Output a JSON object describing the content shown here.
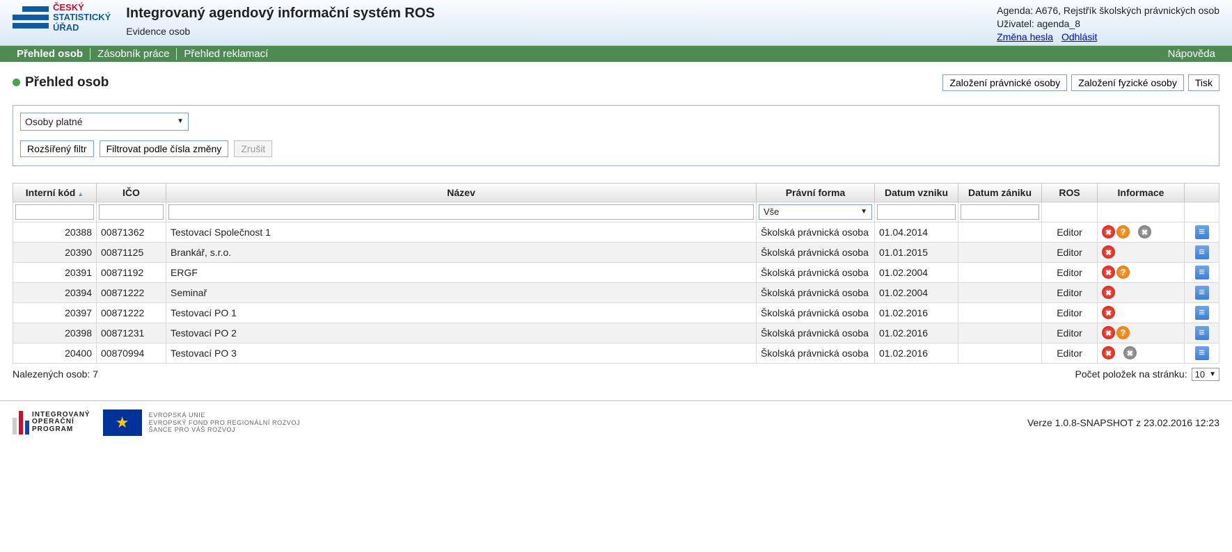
{
  "header": {
    "logo": {
      "line1": "ČESKÝ",
      "line2": "STATISTICKÝ",
      "line3": "ÚŘAD"
    },
    "title": "Integrovaný agendový informační systém ROS",
    "subtitle": "Evidence osob",
    "agenda_label": "Agenda:",
    "agenda_value": "A676, Rejstřík školských právnických osob",
    "user_label": "Uživatel:",
    "user_value": "agenda_8",
    "link_change_pw": "Změna hesla",
    "link_logout": "Odhlásit"
  },
  "nav": {
    "items": [
      "Přehled osob",
      "Zásobník práce",
      "Přehled reklamací"
    ],
    "help": "Nápověda"
  },
  "page": {
    "title": "Přehled osob",
    "btn_create_legal": "Založení právnické osoby",
    "btn_create_natural": "Založení fyzické osoby",
    "btn_print": "Tisk"
  },
  "filter": {
    "select_value": "Osoby platné",
    "btn_ext_filter": "Rozšířený filtr",
    "btn_filter_by_change": "Filtrovat podle čísla změny",
    "btn_cancel": "Zrušit"
  },
  "grid": {
    "columns": {
      "kod": "Interní kód",
      "ico": "IČO",
      "nazev": "Název",
      "pf": "Právní forma",
      "dv": "Datum vzniku",
      "dz": "Datum zániku",
      "ros": "ROS",
      "info": "Informace"
    },
    "filter_pf_value": "Vše",
    "rows": [
      {
        "kod": "20388",
        "ico": "00871362",
        "nazev": "Testovací Společnost 1",
        "pf": "Školská právnická osoba",
        "dv": "01.04.2014",
        "dz": "",
        "ros": "Editor",
        "icons": [
          "x-red",
          "q-orange",
          "x-grey"
        ]
      },
      {
        "kod": "20390",
        "ico": "00871125",
        "nazev": "Brankář, s.r.o.",
        "pf": "Školská právnická osoba",
        "dv": "01.01.2015",
        "dz": "",
        "ros": "Editor",
        "icons": [
          "x-red"
        ]
      },
      {
        "kod": "20391",
        "ico": "00871192",
        "nazev": "ERGF",
        "pf": "Školská právnická osoba",
        "dv": "01.02.2004",
        "dz": "",
        "ros": "Editor",
        "icons": [
          "x-red",
          "q-orange"
        ]
      },
      {
        "kod": "20394",
        "ico": "00871222",
        "nazev": "Seminař",
        "pf": "Školská právnická osoba",
        "dv": "01.02.2004",
        "dz": "",
        "ros": "Editor",
        "icons": [
          "x-red"
        ]
      },
      {
        "kod": "20397",
        "ico": "00871222",
        "nazev": "Testovací PO 1",
        "pf": "Školská právnická osoba",
        "dv": "01.02.2016",
        "dz": "",
        "ros": "Editor",
        "icons": [
          "x-red"
        ]
      },
      {
        "kod": "20398",
        "ico": "00871231",
        "nazev": "Testovací PO 2",
        "pf": "Školská právnická osoba",
        "dv": "01.02.2016",
        "dz": "",
        "ros": "Editor",
        "icons": [
          "x-red",
          "q-orange"
        ]
      },
      {
        "kod": "20400",
        "ico": "00870994",
        "nazev": "Testovací PO 3",
        "pf": "Školská právnická osoba",
        "dv": "01.02.2016",
        "dz": "",
        "ros": "Editor",
        "icons": [
          "x-red",
          "x-grey"
        ]
      }
    ]
  },
  "below": {
    "result_count_label": "Nalezených osob:",
    "result_count_value": "7",
    "per_page_label": "Počet položek na stránku:",
    "per_page_value": "10"
  },
  "footer": {
    "iop_line1": "INTEGROVANÝ",
    "iop_line2": "OPERAČNÍ",
    "iop_line3": "PROGRAM",
    "eu_line1": "Evropská unie",
    "eu_line2": "Evropský fond pro regionální rozvoj",
    "eu_line3": "Šance pro váš rozvoj",
    "version": "Verze 1.0.8-SNAPSHOT z 23.02.2016 12:23"
  }
}
